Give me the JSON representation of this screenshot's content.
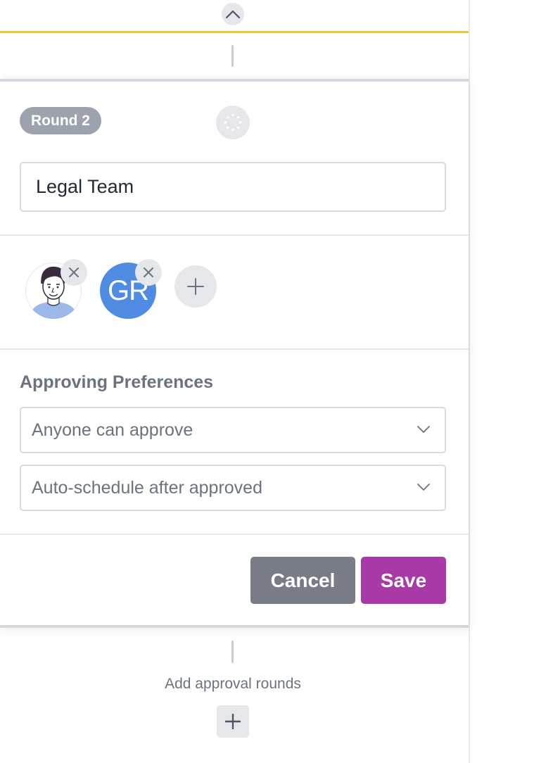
{
  "round": {
    "badge_label": "Round 2",
    "name_value": "Legal Team"
  },
  "members": [
    {
      "type": "photo",
      "icon": "person-avatar-icon"
    },
    {
      "type": "initials",
      "initials": "GR",
      "color": "#4f8be0"
    }
  ],
  "preferences": {
    "title": "Approving Preferences",
    "approval_mode": "Anyone can approve",
    "schedule_mode": "Auto-schedule after approved"
  },
  "actions": {
    "cancel_label": "Cancel",
    "save_label": "Save"
  },
  "footer": {
    "add_rounds_label": "Add approval rounds"
  },
  "colors": {
    "accent_gold": "#e8c93a",
    "save": "#a83aa8",
    "cancel": "#777c86",
    "badge": "#9ca3af"
  }
}
